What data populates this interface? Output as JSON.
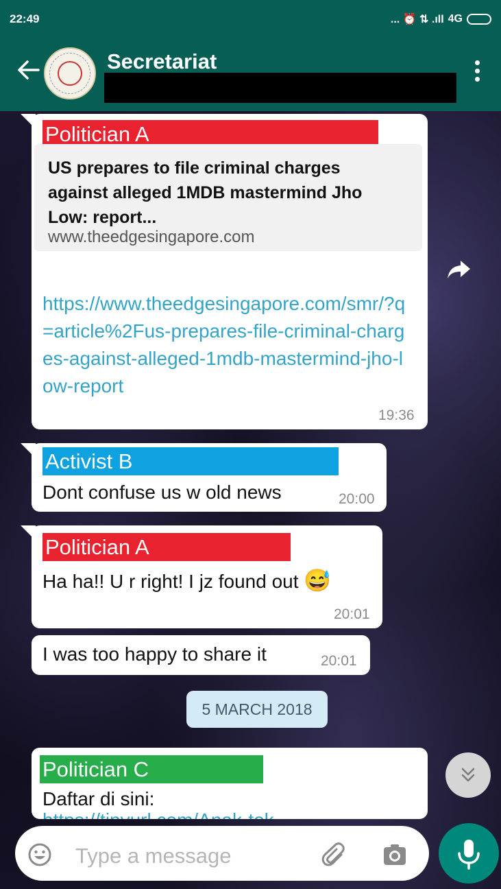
{
  "status_bar": {
    "time": "22:49",
    "network": "4G",
    "indicators": "... ⏰ ⇅ .ıll"
  },
  "header": {
    "title": "Secretariat"
  },
  "messages": [
    {
      "sender": "Politician A",
      "sender_color": "#e8232f",
      "preview_title": "US prepares to file criminal charges against alleged 1MDB mastermind Jho Low: report...",
      "preview_url": "www.theedgesingapore.com",
      "link": "https://www.theedgesingapore.com/smr/?q=article%2Fus-prepares-file-criminal-charges-against-alleged-1mdb-mastermind-jho-low-report",
      "time": "19:36"
    },
    {
      "sender": "Activist B",
      "sender_color": "#0ea2e0",
      "text": "Dont confuse us w old news",
      "time": "20:00"
    },
    {
      "sender": "Politician A",
      "sender_color": "#e8232f",
      "text": "Ha ha!! U r right! I jz found out",
      "emoji": "😅",
      "time": "20:01"
    },
    {
      "text": "I was too happy to share it",
      "time": "20:01"
    },
    {
      "sender": "Politician C",
      "sender_color": "#27ae4a",
      "text": "Daftar di sini:",
      "link_partial": "https://tinyurl.com/Anak-tok..."
    }
  ],
  "date_divider": "5 MARCH 2018",
  "input": {
    "placeholder": "Type a message"
  },
  "icons": {
    "back": "back-arrow-icon",
    "menu": "more-vert-icon",
    "share": "share-icon",
    "scroll": "double-chevron-down-icon",
    "emoji": "emoji-icon",
    "attach": "paperclip-icon",
    "camera": "camera-icon",
    "mic": "mic-icon"
  },
  "colors": {
    "header": "#075e54",
    "accent": "#00897b",
    "link": "#34a3c8"
  }
}
